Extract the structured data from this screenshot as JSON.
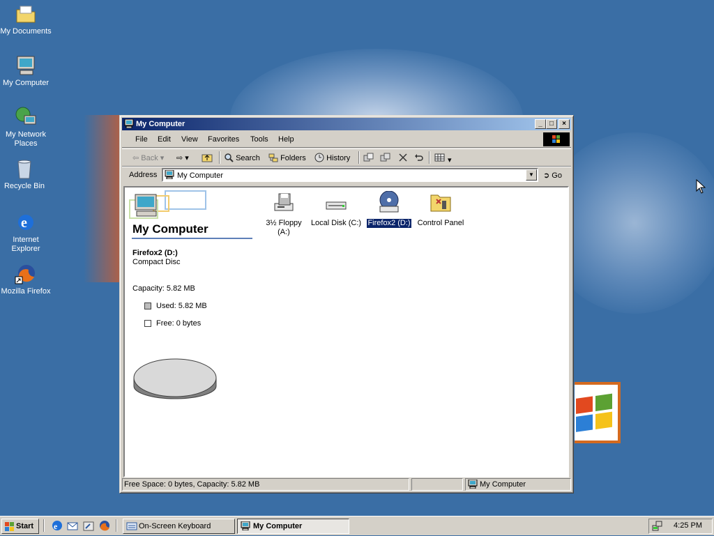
{
  "desktop": {
    "icons": [
      {
        "label": "My Documents"
      },
      {
        "label": "My Computer"
      },
      {
        "label": "My Network Places"
      },
      {
        "label": "Recycle Bin"
      },
      {
        "label": "Internet Explorer"
      },
      {
        "label": "Mozilla Firefox"
      }
    ]
  },
  "window": {
    "title": "My Computer",
    "menu": [
      "File",
      "Edit",
      "View",
      "Favorites",
      "Tools",
      "Help"
    ],
    "toolbar": {
      "back": "Back",
      "search": "Search",
      "folders": "Folders",
      "history": "History"
    },
    "address": {
      "label": "Address",
      "value": "My Computer",
      "go": "Go"
    },
    "info_pane": {
      "title": "My Computer",
      "item_name": "Firefox2 (D:)",
      "item_type": "Compact Disc",
      "capacity": "Capacity: 5.82 MB",
      "used": "Used: 5.82 MB",
      "free": "Free: 0 bytes"
    },
    "items": [
      {
        "label": "3½ Floppy (A:)",
        "icon": "floppy-drive-icon"
      },
      {
        "label": "Local Disk (C:)",
        "icon": "hard-disk-icon"
      },
      {
        "label": "Firefox2 (D:)",
        "icon": "cd-drive-icon",
        "selected": true
      },
      {
        "label": "Control Panel",
        "icon": "control-panel-icon"
      }
    ],
    "status": {
      "left": "Free Space: 0 bytes, Capacity: 5.82 MB",
      "zone": "My Computer"
    }
  },
  "taskbar": {
    "start": "Start",
    "tasks": [
      {
        "label": "On-Screen Keyboard",
        "active": false
      },
      {
        "label": "My Computer",
        "active": true
      }
    ],
    "clock": "4:25 PM"
  },
  "colors": {
    "desktop": "#3a6ea5",
    "titlebar": "#0a246a",
    "face": "#d4d0c8",
    "selection": "#0a246a"
  }
}
